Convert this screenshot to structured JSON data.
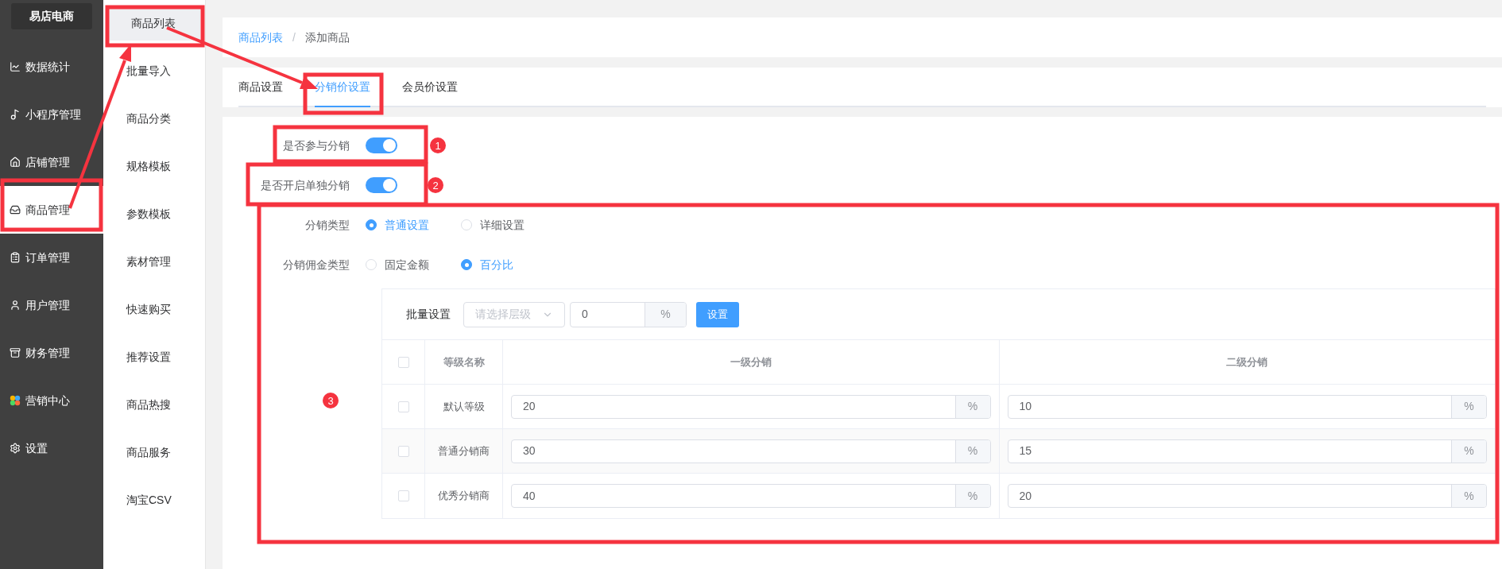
{
  "sidebar": {
    "logo": "易店电商",
    "items": [
      {
        "label": "数据统计",
        "selected": false
      },
      {
        "label": "小程序管理",
        "selected": false
      },
      {
        "label": "店铺管理",
        "selected": false
      },
      {
        "label": "商品管理",
        "selected": true
      },
      {
        "label": "订单管理",
        "selected": false
      },
      {
        "label": "用户管理",
        "selected": false
      },
      {
        "label": "财务管理",
        "selected": false
      },
      {
        "label": "营销中心",
        "selected": false
      },
      {
        "label": "设置",
        "selected": false
      }
    ]
  },
  "submenu": {
    "items": [
      {
        "label": "商品列表",
        "selected": true
      },
      {
        "label": "批量导入",
        "selected": false
      },
      {
        "label": "商品分类",
        "selected": false
      },
      {
        "label": "规格模板",
        "selected": false
      },
      {
        "label": "参数模板",
        "selected": false
      },
      {
        "label": "素材管理",
        "selected": false
      },
      {
        "label": "快速购买",
        "selected": false
      },
      {
        "label": "推荐设置",
        "selected": false
      },
      {
        "label": "商品热搜",
        "selected": false
      },
      {
        "label": "商品服务",
        "selected": false
      },
      {
        "label": "淘宝CSV",
        "selected": false
      }
    ]
  },
  "breadcrumb": {
    "items": [
      "商品列表",
      "添加商品"
    ],
    "separator": "/"
  },
  "tabs": [
    {
      "label": "商品设置",
      "selected": false
    },
    {
      "label": "分销价设置",
      "selected": true
    },
    {
      "label": "会员价设置",
      "selected": false
    }
  ],
  "switches": [
    {
      "label": "是否参与分销",
      "on": true
    },
    {
      "label": "是否开启单独分销",
      "on": true
    }
  ],
  "radio_groups": [
    {
      "label": "分销类型",
      "options": [
        {
          "label": "普通设置",
          "selected": true
        },
        {
          "label": "详细设置",
          "selected": false
        }
      ]
    },
    {
      "label": "分销佣金类型",
      "options": [
        {
          "label": "固定金额",
          "selected": false
        },
        {
          "label": "百分比",
          "selected": true
        }
      ]
    }
  ],
  "batch": {
    "label": "批量设置",
    "select_placeholder": "请选择层级",
    "value": "0",
    "unit": "%",
    "button": "设置"
  },
  "table": {
    "columns": [
      {
        "kind": "checkbox",
        "checked": false
      },
      {
        "kind": "text",
        "label": "等级名称"
      },
      {
        "kind": "text",
        "label": "一级分销"
      },
      {
        "kind": "text",
        "label": "二级分销"
      }
    ],
    "rows": [
      {
        "cells": [
          {
            "kind": "checkbox",
            "checked": false
          },
          {
            "kind": "text",
            "value": "默认等级"
          },
          {
            "kind": "input",
            "value": "20",
            "unit": "%"
          },
          {
            "kind": "input",
            "value": "10",
            "unit": "%"
          }
        ]
      },
      {
        "cells": [
          {
            "kind": "checkbox",
            "checked": false
          },
          {
            "kind": "text",
            "value": "普通分销商"
          },
          {
            "kind": "input",
            "value": "30",
            "unit": "%"
          },
          {
            "kind": "input",
            "value": "15",
            "unit": "%"
          }
        ]
      },
      {
        "cells": [
          {
            "kind": "checkbox",
            "checked": false
          },
          {
            "kind": "text",
            "value": "优秀分销商"
          },
          {
            "kind": "input",
            "value": "40",
            "unit": "%"
          },
          {
            "kind": "input",
            "value": "20",
            "unit": "%"
          }
        ]
      }
    ]
  },
  "annotations": {
    "markers": [
      "1",
      "2",
      "3"
    ]
  }
}
